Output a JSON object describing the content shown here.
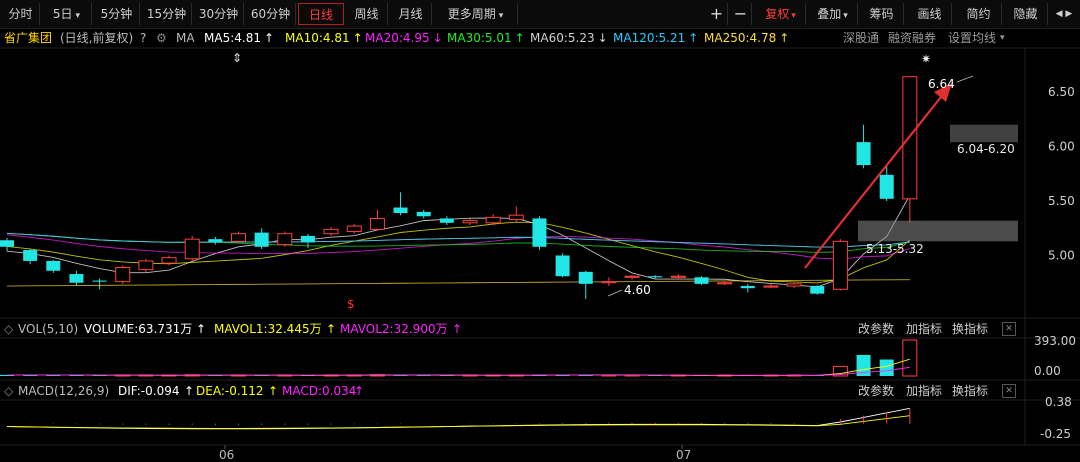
{
  "toolbar": {
    "left": [
      "分时",
      "5日",
      "5分钟",
      "15分钟",
      "30分钟",
      "60分钟",
      "日线",
      "周线",
      "月线",
      "更多周期"
    ],
    "active": "日线",
    "plus": "+",
    "minus": "−",
    "right": [
      "复权",
      "叠加",
      "筹码",
      "画线",
      "简约",
      "隐藏"
    ],
    "dropdown_arrow": "▾",
    "nav_arrows": "◀ ▶"
  },
  "header": {
    "stock": "省广集团",
    "mode": "(日线,前复权)",
    "help": "?",
    "ma_label": "MA",
    "ma_values": [
      {
        "label": "MA5:4.81",
        "arrow": "↑",
        "color": "#ffffff"
      },
      {
        "label": "MA10:4.81",
        "arrow": "↑",
        "color": "#ffff00"
      },
      {
        "label": "MA20:4.95",
        "arrow": "↓",
        "color": "#ff22ff"
      },
      {
        "label": "MA30:5.01",
        "arrow": "↑",
        "color": "#22ee22"
      },
      {
        "label": "MA60:5.23",
        "arrow": "↓",
        "color": "#cfcfcf"
      },
      {
        "label": "MA120:5.21",
        "arrow": "↑",
        "color": "#22ccff"
      },
      {
        "label": "MA250:4.78",
        "arrow": "↑",
        "color": "#ffdd33"
      }
    ],
    "links": [
      "深股通",
      "融资融券",
      "设置均线"
    ]
  },
  "annotations": {
    "high": "6.64",
    "low": "4.60",
    "zone_upper": "6.04-6.20",
    "zone_lower": "5.13-5.32",
    "dollar": "$",
    "star": "✷",
    "updown": "⇕"
  },
  "vol_panel": {
    "name": "VOL(5,10)",
    "volume": "VOLUME:63.731万",
    "mavol1": "MAVOL1:32.445万",
    "mavol2": "MAVOL2:32.900万",
    "buttons": [
      "改参数",
      "加指标",
      "换指标"
    ],
    "close": "✕",
    "axis": [
      "393.00",
      "0.00"
    ]
  },
  "macd_panel": {
    "name": "MACD(12,26,9)",
    "dif": "DIF:-0.094",
    "dea": "DEA:-0.112",
    "macd": "MACD:0.034",
    "buttons": [
      "改参数",
      "加指标",
      "换指标"
    ],
    "close": "✕",
    "axis": [
      "0.38",
      "-0.25"
    ]
  },
  "chart_data": {
    "type": "candlestick",
    "price_axis": [
      6.5,
      6.0,
      5.5,
      5.0
    ],
    "x_labels": [
      "06",
      "07"
    ],
    "colors": {
      "up": "#ff4040",
      "down": "#22e5e5"
    },
    "candles": [
      {
        "o": 5.14,
        "c": 5.08,
        "h": 5.16,
        "l": 5.04
      },
      {
        "o": 5.05,
        "c": 4.95,
        "h": 5.06,
        "l": 4.92
      },
      {
        "o": 4.95,
        "c": 4.86,
        "h": 4.96,
        "l": 4.84
      },
      {
        "o": 4.83,
        "c": 4.75,
        "h": 4.86,
        "l": 4.72
      },
      {
        "o": 4.77,
        "c": 4.76,
        "h": 4.79,
        "l": 4.69
      },
      {
        "o": 4.76,
        "c": 4.89,
        "h": 4.91,
        "l": 4.74
      },
      {
        "o": 4.87,
        "c": 4.95,
        "h": 4.97,
        "l": 4.85
      },
      {
        "o": 4.93,
        "c": 4.98,
        "h": 5.0,
        "l": 4.91
      },
      {
        "o": 4.97,
        "c": 5.15,
        "h": 5.18,
        "l": 4.95
      },
      {
        "o": 5.15,
        "c": 5.12,
        "h": 5.17,
        "l": 5.1
      },
      {
        "o": 5.13,
        "c": 5.2,
        "h": 5.22,
        "l": 5.11
      },
      {
        "o": 5.21,
        "c": 5.08,
        "h": 5.25,
        "l": 5.06
      },
      {
        "o": 5.1,
        "c": 5.2,
        "h": 5.22,
        "l": 5.08
      },
      {
        "o": 5.18,
        "c": 5.12,
        "h": 5.2,
        "l": 5.07
      },
      {
        "o": 5.2,
        "c": 5.24,
        "h": 5.26,
        "l": 5.18
      },
      {
        "o": 5.22,
        "c": 5.27,
        "h": 5.29,
        "l": 5.2
      },
      {
        "o": 5.24,
        "c": 5.34,
        "h": 5.42,
        "l": 5.23
      },
      {
        "o": 5.44,
        "c": 5.39,
        "h": 5.58,
        "l": 5.37
      },
      {
        "o": 5.4,
        "c": 5.36,
        "h": 5.42,
        "l": 5.34
      },
      {
        "o": 5.34,
        "c": 5.3,
        "h": 5.36,
        "l": 5.28
      },
      {
        "o": 5.3,
        "c": 5.32,
        "h": 5.34,
        "l": 5.28
      },
      {
        "o": 5.3,
        "c": 5.35,
        "h": 5.38,
        "l": 5.28
      },
      {
        "o": 5.33,
        "c": 5.37,
        "h": 5.45,
        "l": 5.31
      },
      {
        "o": 5.34,
        "c": 5.08,
        "h": 5.36,
        "l": 5.05
      },
      {
        "o": 5.0,
        "c": 4.81,
        "h": 5.02,
        "l": 4.8
      },
      {
        "o": 4.85,
        "c": 4.74,
        "h": 4.86,
        "l": 4.6
      },
      {
        "o": 4.75,
        "c": 4.76,
        "h": 4.8,
        "l": 4.72
      },
      {
        "o": 4.8,
        "c": 4.81,
        "h": 4.82,
        "l": 4.78
      },
      {
        "o": 4.81,
        "c": 4.8,
        "h": 4.82,
        "l": 4.79
      },
      {
        "o": 4.8,
        "c": 4.81,
        "h": 4.83,
        "l": 4.79
      },
      {
        "o": 4.8,
        "c": 4.74,
        "h": 4.81,
        "l": 4.73
      },
      {
        "o": 4.74,
        "c": 4.75,
        "h": 4.77,
        "l": 4.73
      },
      {
        "o": 4.72,
        "c": 4.7,
        "h": 4.74,
        "l": 4.66
      },
      {
        "o": 4.71,
        "c": 4.72,
        "h": 4.74,
        "l": 4.7
      },
      {
        "o": 4.72,
        "c": 4.74,
        "h": 4.75,
        "l": 4.7
      },
      {
        "o": 4.72,
        "c": 4.65,
        "h": 4.73,
        "l": 4.64
      },
      {
        "o": 4.69,
        "c": 5.13,
        "h": 5.15,
        "l": 4.68
      },
      {
        "o": 6.04,
        "c": 5.83,
        "h": 6.2,
        "l": 5.8
      },
      {
        "o": 5.74,
        "c": 5.52,
        "h": 5.84,
        "l": 5.5
      },
      {
        "o": 5.52,
        "c": 6.64,
        "h": 6.64,
        "l": 5.3
      }
    ],
    "volumes": [
      12,
      9,
      10,
      8,
      7,
      9,
      8,
      8,
      13,
      7,
      8,
      9,
      8,
      7,
      9,
      10,
      14,
      9,
      8,
      7,
      7,
      8,
      9,
      15,
      12,
      11,
      8,
      6,
      5,
      5,
      8,
      6,
      7,
      6,
      7,
      9,
      105,
      230,
      180,
      393
    ],
    "volume_axis": [
      0,
      393
    ],
    "macd_axis": [
      -0.25,
      0.38
    ]
  }
}
